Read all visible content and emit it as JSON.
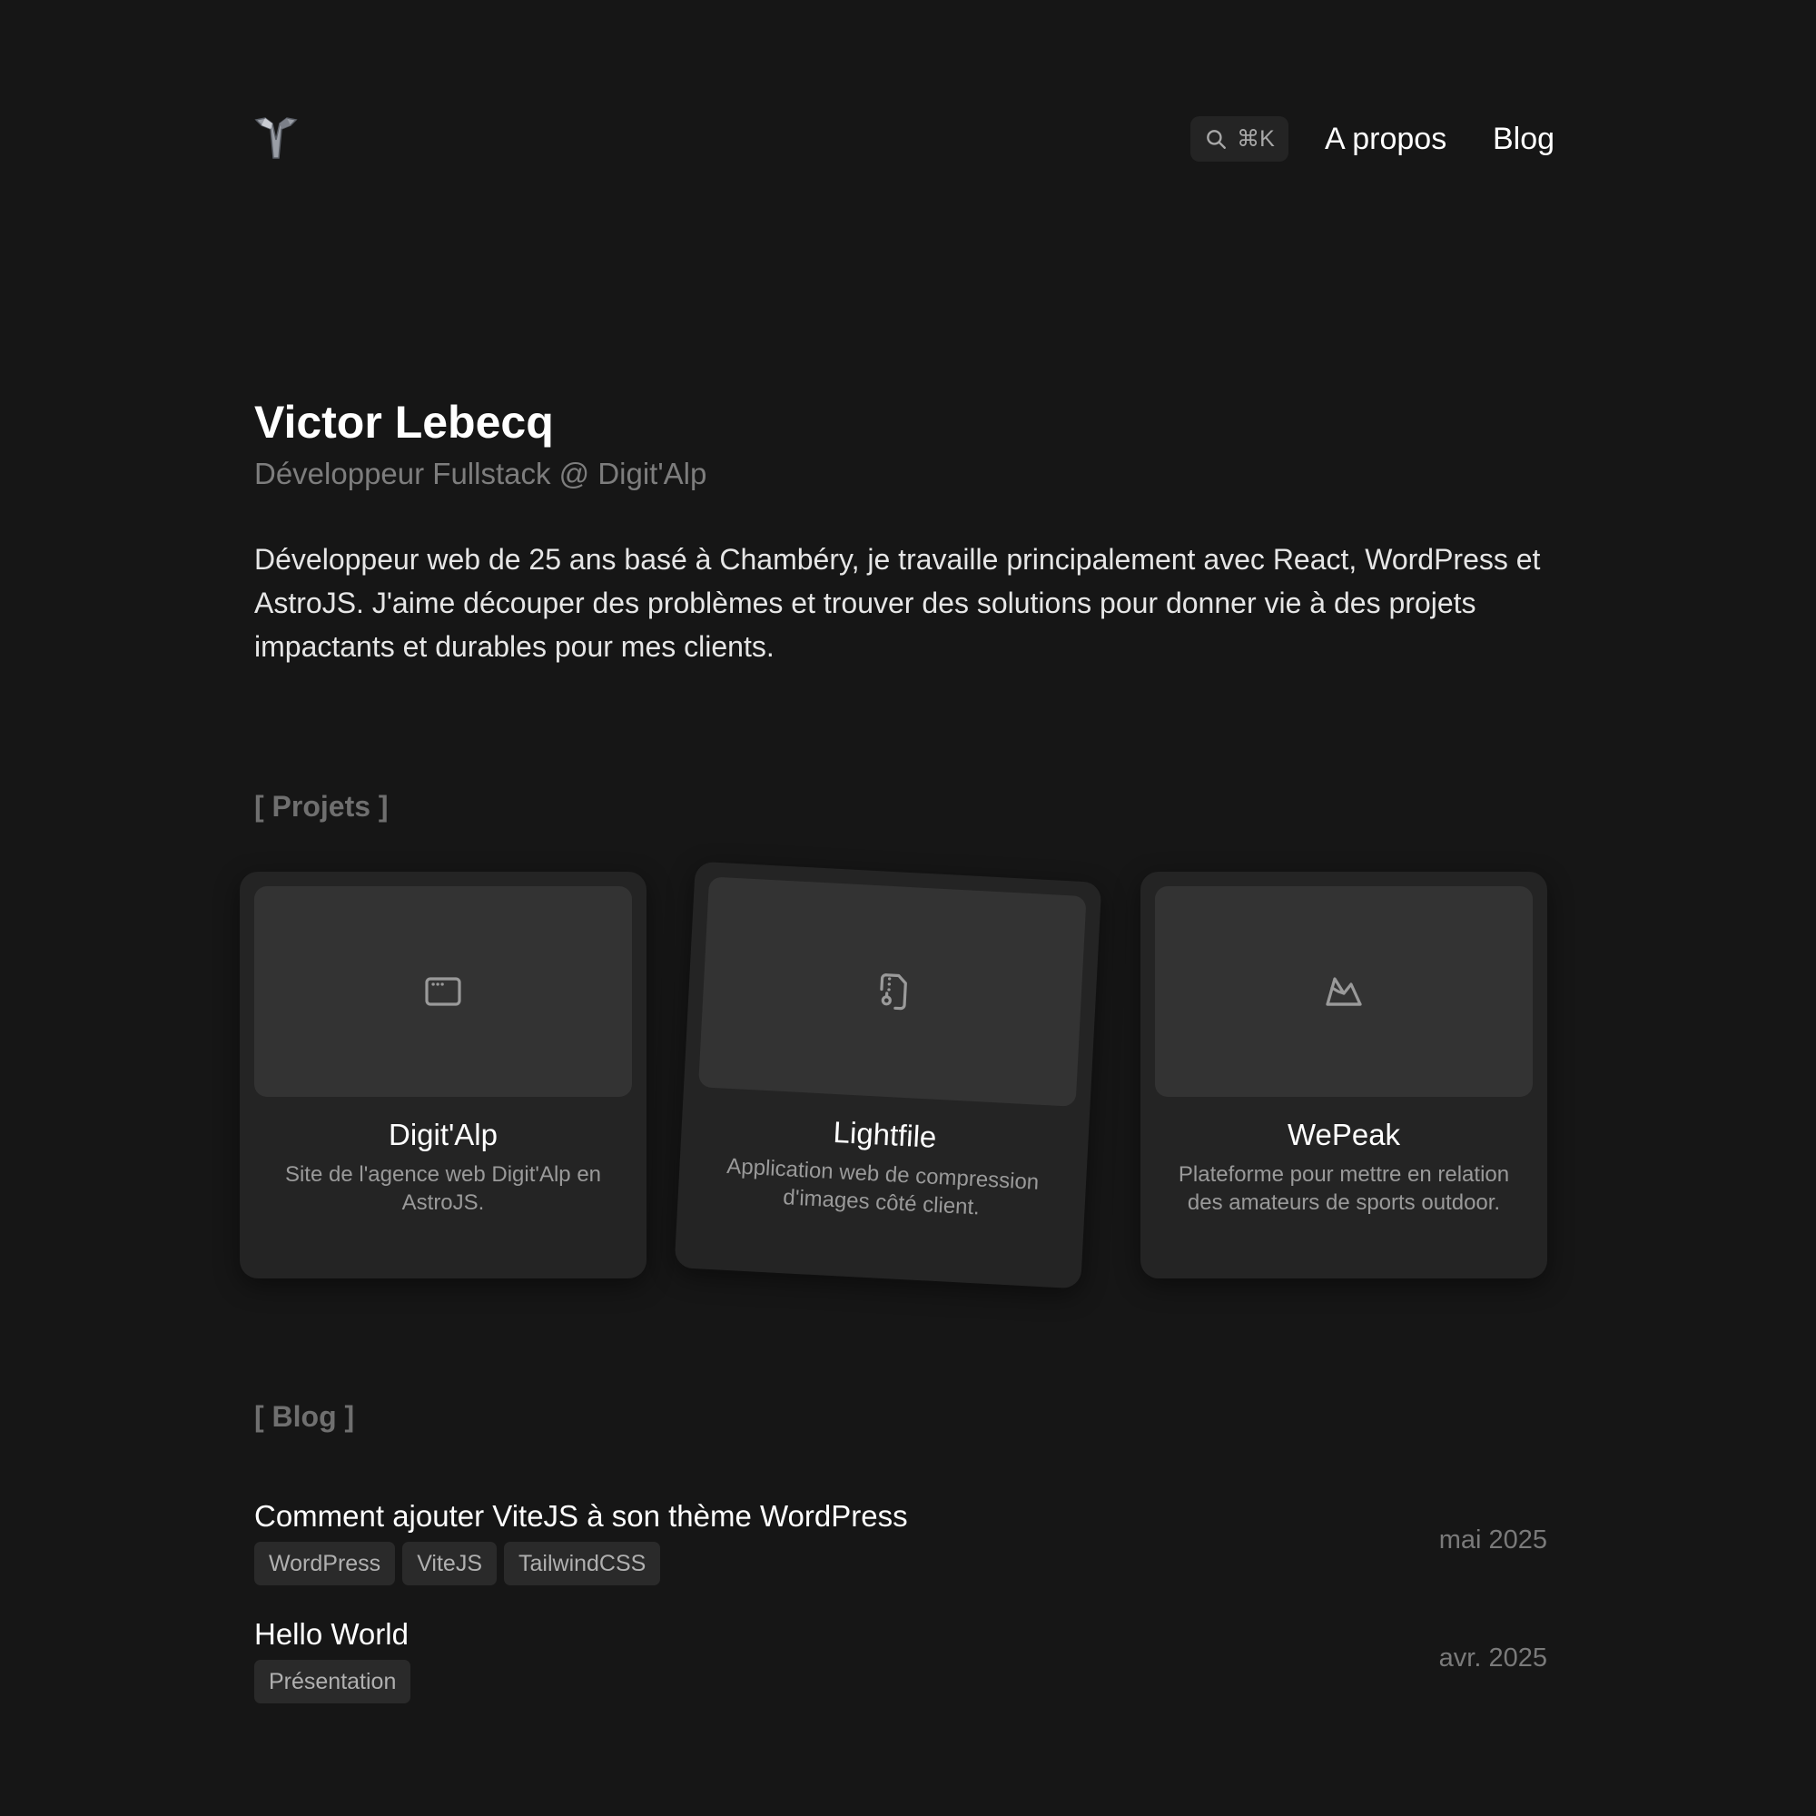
{
  "header": {
    "search_shortcut": "⌘K",
    "nav": [
      {
        "label": "A propos"
      },
      {
        "label": "Blog"
      }
    ]
  },
  "intro": {
    "name": "Victor Lebecq",
    "role": "Développeur Fullstack @ Digit'Alp",
    "bio": "Développeur web de 25 ans basé à Chambéry, je travaille principalement avec React, WordPress et AstroJS. J'aime découper des problèmes et trouver des solutions pour donner vie à des projets impactants et durables pour mes clients."
  },
  "projects": {
    "heading": "[ Projets ]",
    "items": [
      {
        "title": "Digit'Alp",
        "description": "Site de l'agence web Digit'Alp en AstroJS.",
        "icon": "browser-window-icon"
      },
      {
        "title": "Lightfile",
        "description": "Application web de compression d'images côté client.",
        "icon": "file-zip-icon"
      },
      {
        "title": "WePeak",
        "description": "Plateforme pour mettre en relation des amateurs de sports outdoor.",
        "icon": "mountain-icon"
      }
    ]
  },
  "blog": {
    "heading": "[ Blog ]",
    "posts": [
      {
        "title": "Comment ajouter ViteJS à son thème WordPress",
        "tags": [
          "WordPress",
          "ViteJS",
          "TailwindCSS"
        ],
        "date": "mai 2025"
      },
      {
        "title": "Hello World",
        "tags": [
          "Présentation"
        ],
        "date": "avr. 2025"
      }
    ]
  },
  "colors": {
    "background": "#161616",
    "card": "#242424",
    "thumb": "#333333",
    "muted": "#7d7d7d"
  }
}
